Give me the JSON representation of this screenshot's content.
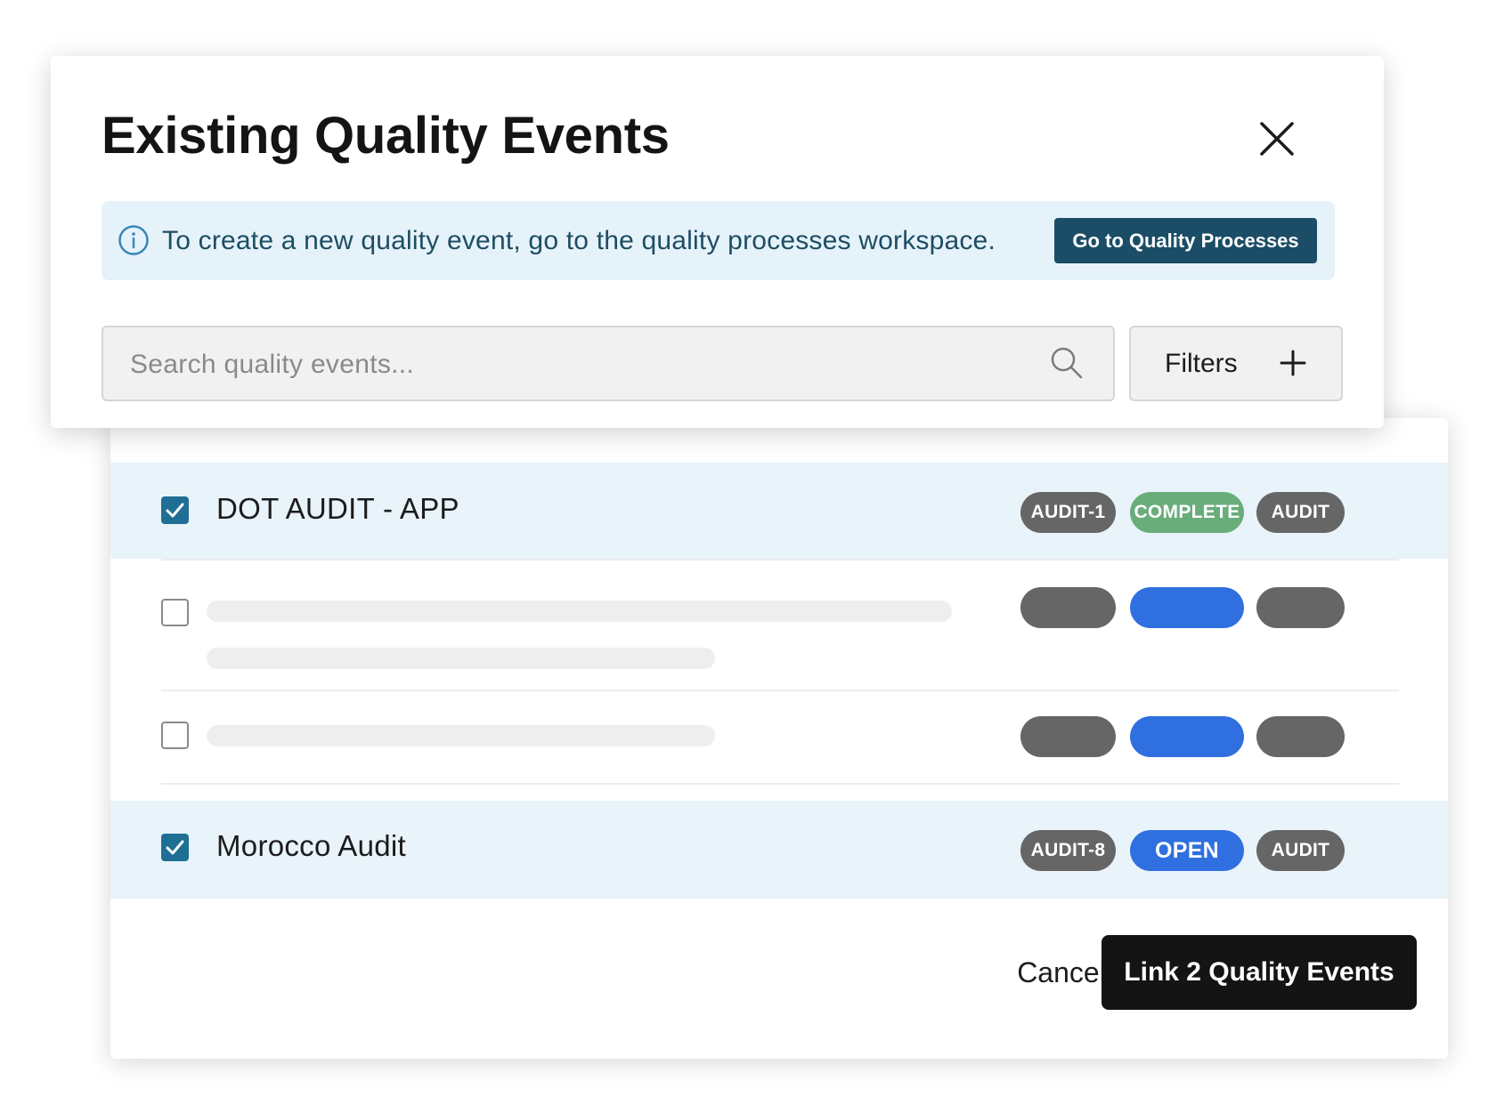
{
  "dialog": {
    "title": "Existing Quality Events",
    "banner": {
      "message": "To create a new quality event, go to the quality processes workspace.",
      "button_label": "Go to Quality Processes",
      "icon": "info-icon"
    },
    "search": {
      "placeholder": "Search quality events...",
      "value": "",
      "icon": "search-icon"
    },
    "filters": {
      "label": "Filters",
      "icon": "plus-icon"
    },
    "close_icon": "close-icon"
  },
  "results": [
    {
      "title": "DOT AUDIT - APP",
      "checked": true,
      "tags": [
        {
          "label": "AUDIT-1",
          "color": "#666666"
        },
        {
          "label": "COMPLETE",
          "color": "#69ad7b"
        },
        {
          "label": "AUDIT",
          "color": "#666666"
        }
      ]
    },
    {
      "title": "",
      "checked": false,
      "loading": true,
      "tags": [
        {
          "label": "",
          "color": "#666666"
        },
        {
          "label": "",
          "color": "#2f6fe0"
        },
        {
          "label": "",
          "color": "#666666"
        }
      ]
    },
    {
      "title": "",
      "checked": false,
      "loading": true,
      "tags": [
        {
          "label": "",
          "color": "#666666"
        },
        {
          "label": "",
          "color": "#2f6fe0"
        },
        {
          "label": "",
          "color": "#666666"
        }
      ]
    },
    {
      "title": "Morocco Audit",
      "checked": true,
      "tags": [
        {
          "label": "AUDIT-8",
          "color": "#666666"
        },
        {
          "label": "OPEN",
          "color": "#2f6fe0"
        },
        {
          "label": "AUDIT",
          "color": "#666666"
        }
      ]
    }
  ],
  "footer": {
    "cancel_label": "Cancel",
    "link_label": "Link 2 Quality Events"
  },
  "colors": {
    "selected_row_bg": "#e9f3fa",
    "checkbox_checked": "#1f6f94",
    "banner_bg": "#e6f2fa",
    "banner_button": "#1b4d66",
    "primary_button": "#141414"
  }
}
